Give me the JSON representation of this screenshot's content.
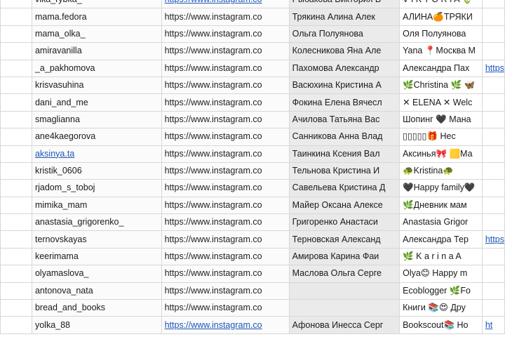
{
  "rows": [
    {
      "username": "vika_rybka_",
      "link": "https://www.instagram.co",
      "link_style": "link",
      "name": "Рыбакова Виктория В",
      "bio": "V I K T O R I A 🌷",
      "extra": ""
    },
    {
      "username": "mama.fedora",
      "link": "https://www.instagram.co",
      "link_style": "plain",
      "name": "Трякина Алина Алек",
      "bio": "АЛИНА🍊ТРЯКИ",
      "extra": ""
    },
    {
      "username": "mama_olka_",
      "link": "https://www.instagram.co",
      "link_style": "plain",
      "name": "Ольга Полуянова",
      "bio": "Оля Полуянова",
      "extra": ""
    },
    {
      "username": "amiravanilla",
      "link": "https://www.instagram.co",
      "link_style": "plain",
      "name": "Колесникова Яна Але",
      "bio": "Yana 📍Москва M",
      "extra": ""
    },
    {
      "username": "_a_pakhomova",
      "link": "https://www.instagram.co",
      "link_style": "plain",
      "name": "Пахомова Александр",
      "bio": "Александра Пах",
      "extra": "https"
    },
    {
      "username": "krisvasuhina",
      "link": "https://www.instagram.co",
      "link_style": "plain",
      "name": "Васюхина Кристина А",
      "bio": "🌿Christina 🌿 🦋",
      "extra": ""
    },
    {
      "username": "dani_and_me",
      "link": "https://www.instagram.co",
      "link_style": "plain",
      "name": "Фокина Елена Вячесл",
      "bio": "✕ ELENA ✕ Welc",
      "extra": ""
    },
    {
      "username": "smaglianna",
      "link": "https://www.instagram.co",
      "link_style": "plain",
      "name": "Ачилова Татьяна Вас",
      "bio": "Шопинг 🖤 Мана",
      "extra": ""
    },
    {
      "username": "ane4kaegorova",
      "link": "https://www.instagram.co",
      "link_style": "plain",
      "name": "Санникова Анна Влад",
      "bio": "▯▯▯▯▯🎁 Нес",
      "extra": ""
    },
    {
      "username": "aksinya.ta",
      "username_style": "link",
      "link": "https://www.instagram.co",
      "link_style": "plain",
      "name": "Таинкина Ксения Вал",
      "bio": "Аксинья🎀 🟨Ма",
      "extra": ""
    },
    {
      "username": "kristik_0606",
      "link": "https://www.instagram.co",
      "link_style": "plain",
      "name": "Тельнова Кристина И",
      "bio": "🐢Kristina🐢",
      "extra": ""
    },
    {
      "username": "rjadom_s_toboj",
      "link": "https://www.instagram.co",
      "link_style": "plain",
      "name": "Савельева Кристина Д",
      "bio": "🖤Happy family🖤",
      "extra": ""
    },
    {
      "username": "mimika_mam",
      "link": "https://www.instagram.co",
      "link_style": "plain",
      "name": "Майер Оксана Алексе",
      "bio": "🌿Дневник мам",
      "extra": ""
    },
    {
      "username": "anastasia_grigorenko_",
      "link": "https://www.instagram.co",
      "link_style": "plain",
      "name": "Григоренко Анастаси",
      "bio": "Anastasia Grigor",
      "extra": ""
    },
    {
      "username": "ternovskayas",
      "link": "https://www.instagram.co",
      "link_style": "plain",
      "name": "Терновская Александ",
      "bio": "Александра Тер",
      "extra": "https"
    },
    {
      "username": "keerimama",
      "link": "https://www.instagram.co",
      "link_style": "plain",
      "name": "Амирова Карина Фаи",
      "bio": "🌿 K a r i n a A",
      "extra": ""
    },
    {
      "username": "olyamaslova_",
      "link": "https://www.instagram.co",
      "link_style": "plain",
      "name": "Маслова Ольга Серге",
      "bio": "Olya😊 Happy m",
      "extra": ""
    },
    {
      "username": "antonova_nata",
      "link": "https://www.instagram.co",
      "link_style": "plain",
      "name": "",
      "bio": "Ecoblogger 🌿Fo",
      "extra": ""
    },
    {
      "username": "bread_and_books",
      "link": "https://www.instagram.co",
      "link_style": "plain",
      "name": "",
      "bio": "Книги 📚😍 Дру",
      "extra": ""
    },
    {
      "username": "yolka_88",
      "link": "https://www.instagram.co",
      "link_style": "link",
      "name": "Афонова Инесса Серг",
      "bio": "Bookscout📚 Но",
      "extra": "ht"
    }
  ]
}
